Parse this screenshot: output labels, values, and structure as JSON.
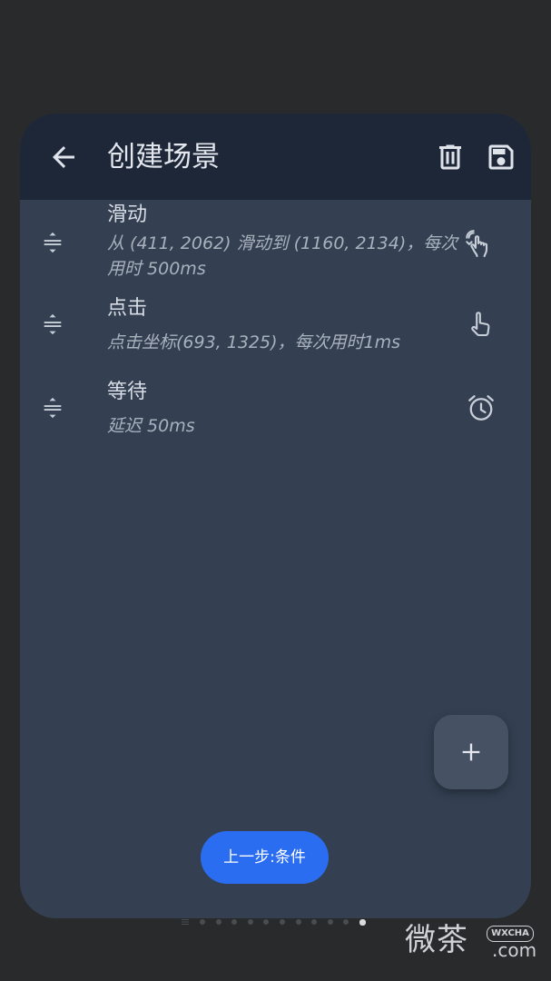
{
  "appbar": {
    "title": "创建场景",
    "back_icon": "arrow-left-icon",
    "delete_icon": "trash-icon",
    "save_icon": "floppy-disk-icon"
  },
  "items": [
    {
      "name": "滑动",
      "desc": "从 (411, 2062) 滑动到 (1160, 2134)，每次用时 500ms",
      "icon": "swipe-gesture-icon"
    },
    {
      "name": "点击",
      "desc": "点击坐标(693, 1325)，每次用时1ms",
      "icon": "tap-gesture-icon"
    },
    {
      "name": "等待",
      "desc": "延迟 50ms",
      "icon": "alarm-clock-icon"
    }
  ],
  "fab": {
    "icon": "plus-icon"
  },
  "bottom": {
    "prev_label": "上一步:条件"
  },
  "pager": {
    "total_dots": 11,
    "active_index": 10
  },
  "watermark": {
    "text": "微茶",
    "badge": "WXCHA",
    "suffix": ".com"
  },
  "colors": {
    "background": "#282a2b",
    "card": "#344052",
    "appbar": "#1d2738",
    "accent": "#2a6df0",
    "fab": "#465264"
  }
}
